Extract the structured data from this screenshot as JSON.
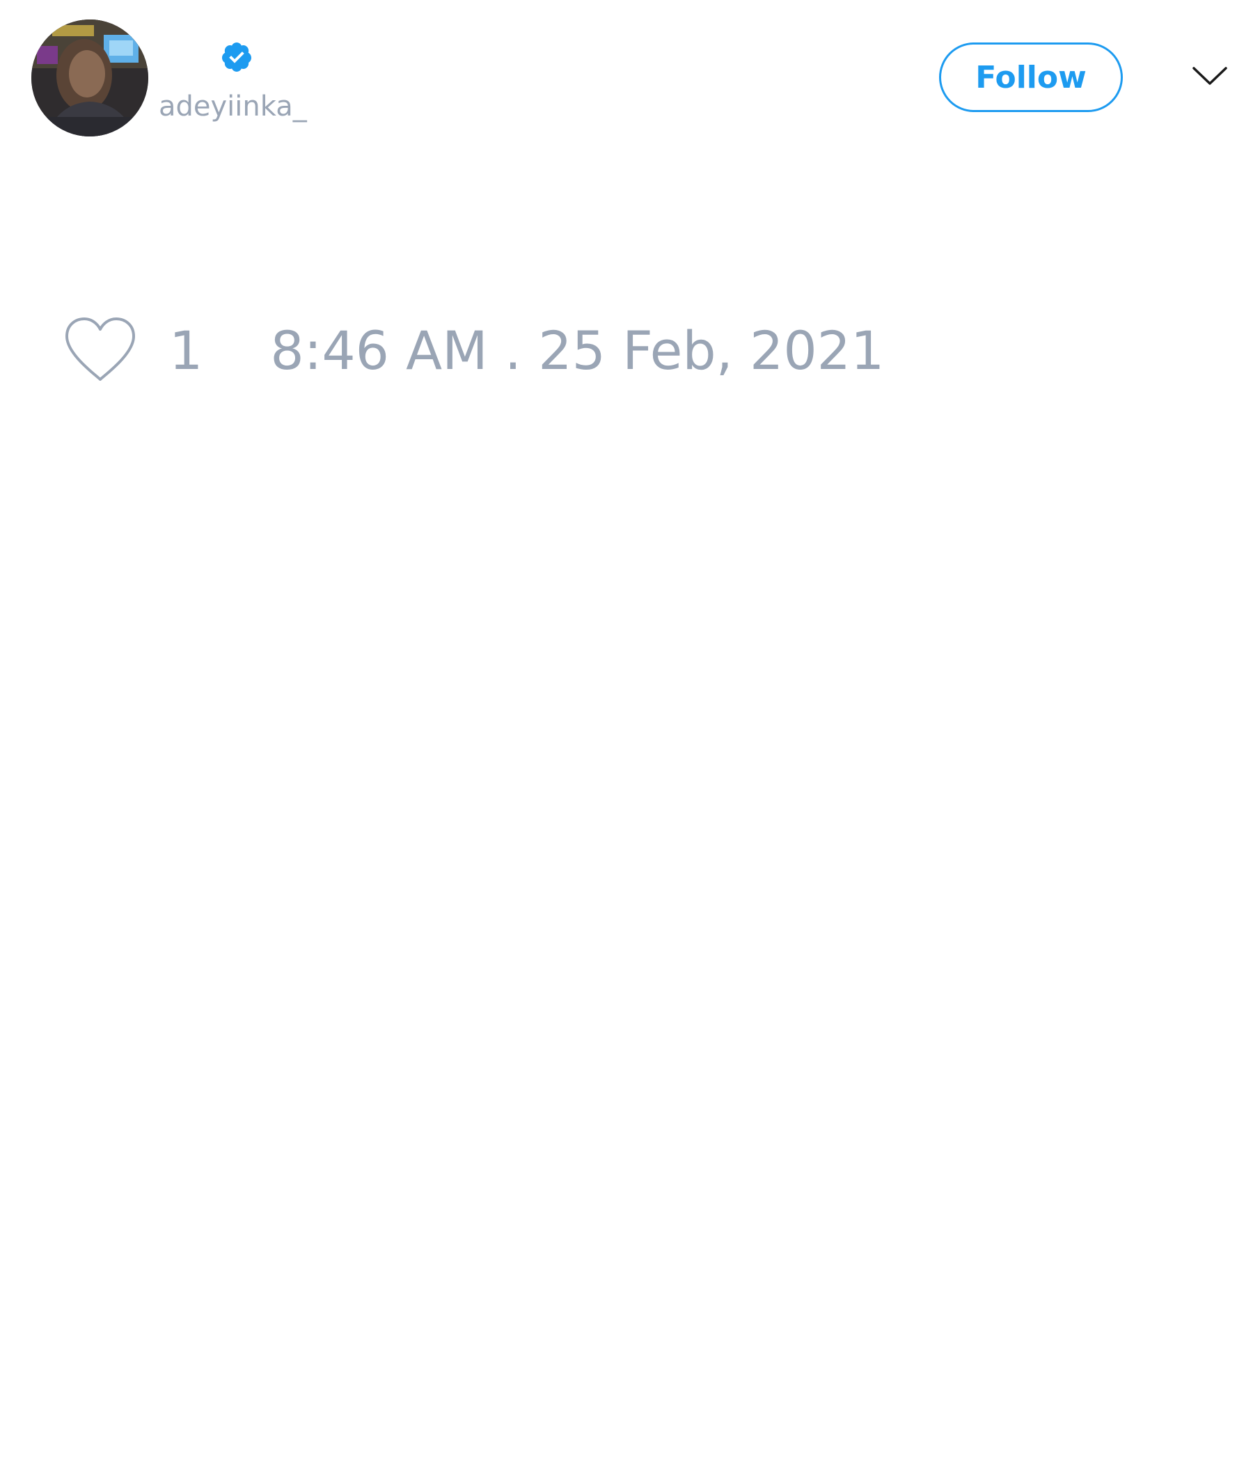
{
  "tweet": {
    "author": {
      "handle": "adeyiinka_",
      "verified_icon": "verified-badge-icon",
      "avatar": "profile-photo"
    },
    "follow_label": "Follow",
    "menu_icon": "chevron-down-icon",
    "like_icon": "heart-icon",
    "like_count": "1",
    "timestamp": "8:46 AM . 25 Feb, 2021"
  },
  "colors": {
    "accent": "#1d9bf0",
    "muted_text": "#9aa5b5",
    "background": "#ffffff"
  }
}
